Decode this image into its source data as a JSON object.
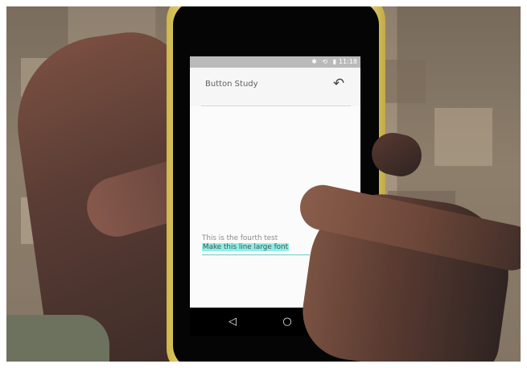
{
  "status_bar": {
    "icons": "✱ ⟲ ▮",
    "time": "11:18"
  },
  "app": {
    "title": "Button Study"
  },
  "toolbar": {
    "undo_icon": "↶"
  },
  "content": {
    "line_1": "This is the fourth test",
    "line_2": "Make this line large font"
  },
  "navbar": {
    "back": "◁",
    "home": "○",
    "recent": "□"
  }
}
